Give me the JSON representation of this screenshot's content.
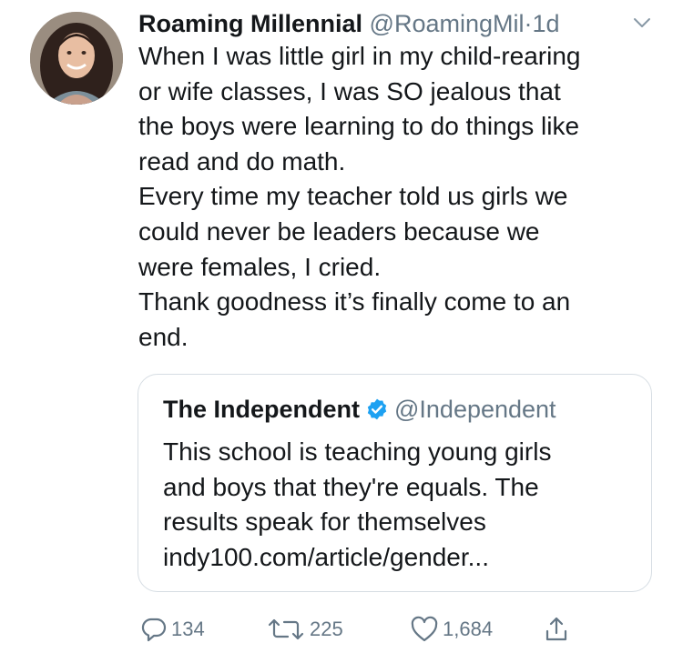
{
  "tweet": {
    "author_name": "Roaming Millennial",
    "author_handle": "@RoamingMil",
    "separator": "·",
    "time": "1d",
    "text": "When I was little girl in my child-rearing\nor wife classes, I was SO jealous that\nthe boys were learning to do things like\nread and do math.\nEvery time my teacher told us girls we\ncould never be leaders because we\nwere females, I cried.\nThank goodness it’s finally come to an\nend."
  },
  "quoted": {
    "author_name": "The Independent",
    "author_handle": "@Independent",
    "verified": true,
    "text": "This school is teaching young girls\nand boys that they're equals. The\nresults speak for themselves\nindy100.com/article/gender..."
  },
  "actions": {
    "replies": "134",
    "retweets": "225",
    "likes": "1,684"
  },
  "colors": {
    "text": "#14171a",
    "secondary": "#657786",
    "border": "#d6dde3",
    "verified": "#1da1f2"
  },
  "icons": [
    "reply-icon",
    "retweet-icon",
    "like-icon",
    "share-icon",
    "caret-down-icon",
    "verified-icon"
  ]
}
